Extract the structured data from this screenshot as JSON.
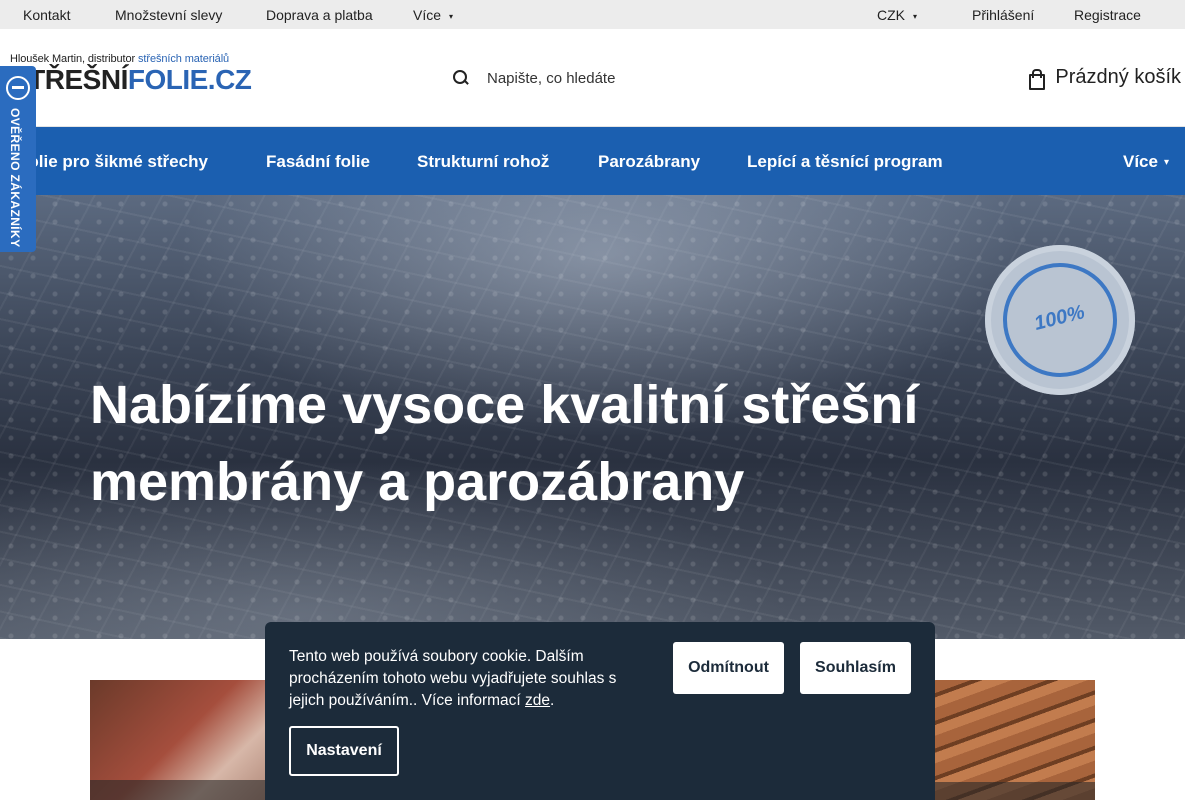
{
  "topbar": {
    "links": [
      "Kontakt",
      "Množstevní slevy",
      "Doprava a platba",
      "Více"
    ],
    "currency": "CZK",
    "login": "Přihlášení",
    "register": "Registrace"
  },
  "header": {
    "logo_tagline_prefix": "Hloušek Martin, distributor ",
    "logo_tagline_highlight": "střešních materiálů",
    "logo_word_dark": "STŘEŠNÍ",
    "logo_word_blue": "FOLIE.CZ",
    "search_placeholder": "Napište, co hledáte",
    "cart_label": "Prázdný košík"
  },
  "nav": {
    "items": [
      "Folie pro šikmé střechy",
      "Fasádní folie",
      "Strukturní rohož",
      "Parozábrany",
      "Lepící a těsnící program"
    ],
    "more": "Více"
  },
  "side_badge": {
    "text": "OVĚŘENO ZÁKAZNÍKY"
  },
  "hero": {
    "title": "Nabízíme vysoce kvalitní střešní membrány a parozábrany",
    "seal_text": "100%"
  },
  "cookie": {
    "text": "Tento web používá soubory cookie. Dalším procházením tohoto webu vyjadřujete souhlas s jejich používáním.. Více informací ",
    "link": "zde",
    "text_end": ".",
    "decline": "Odmítnout",
    "accept": "Souhlasím",
    "settings": "Nastavení"
  },
  "colors": {
    "brand_blue": "#1b5fb0",
    "cookie_bg": "#1c2b3a"
  }
}
